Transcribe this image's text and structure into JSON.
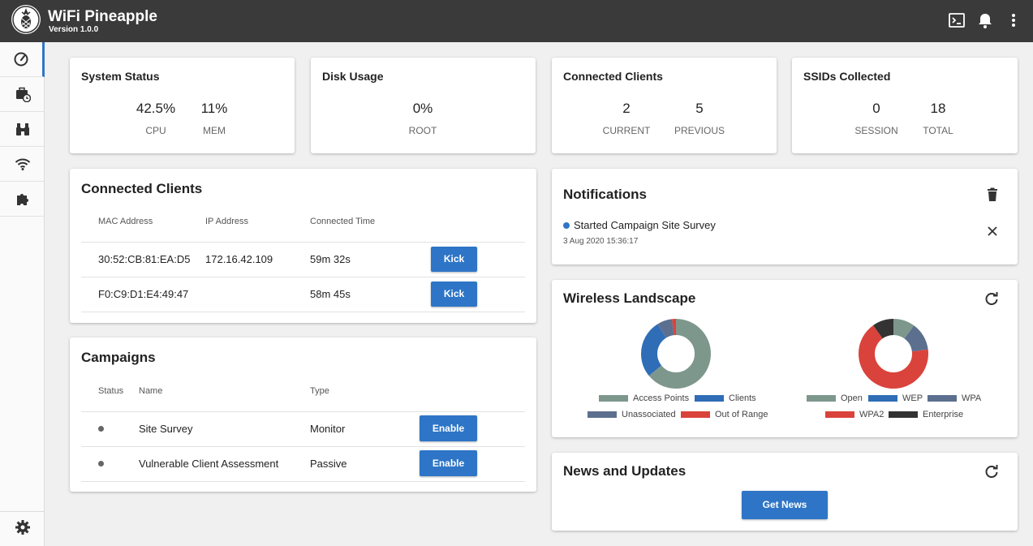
{
  "app": {
    "title": "WiFi Pineapple",
    "version": "Version 1.0.0"
  },
  "topbar": {
    "icons": [
      "terminal-icon",
      "bell-icon",
      "more-vertical-icon"
    ]
  },
  "sidebar": {
    "items": [
      {
        "icon": "dashboard-gauge-icon",
        "active": true
      },
      {
        "icon": "campaigns-briefcase-icon"
      },
      {
        "icon": "recon-binoculars-icon"
      },
      {
        "icon": "wifi-icon"
      },
      {
        "icon": "modules-puzzle-icon"
      }
    ],
    "bottom_icon": "gear-icon"
  },
  "system_status": {
    "title": "System Status",
    "cpu": "42.5%",
    "cpu_label": "CPU",
    "mem": "11%",
    "mem_label": "MEM"
  },
  "disk_usage": {
    "title": "Disk Usage",
    "root": "0%",
    "root_label": "ROOT"
  },
  "connected_summary": {
    "title": "Connected Clients",
    "current": "2",
    "current_label": "CURRENT",
    "previous": "5",
    "previous_label": "PREVIOUS"
  },
  "ssids": {
    "title": "SSIDs Collected",
    "session": "0",
    "session_label": "SESSION",
    "total": "18",
    "total_label": "TOTAL"
  },
  "clients_table": {
    "title": "Connected Clients",
    "headers": [
      "MAC Address",
      "IP Address",
      "Connected Time"
    ],
    "rows": [
      {
        "mac": "30:52:CB:81:EA:D5",
        "ip": "172.16.42.109",
        "time": "59m 32s",
        "action": "Kick"
      },
      {
        "mac": "F0:C9:D1:E4:49:47",
        "ip": "",
        "time": "58m 45s",
        "action": "Kick"
      }
    ]
  },
  "campaigns": {
    "title": "Campaigns",
    "headers": [
      "Status",
      "Name",
      "Type"
    ],
    "rows": [
      {
        "name": "Site Survey",
        "type": "Monitor",
        "action": "Enable"
      },
      {
        "name": "Vulnerable Client Assessment",
        "type": "Passive",
        "action": "Enable"
      }
    ]
  },
  "notifications": {
    "title": "Notifications",
    "items": [
      {
        "text": "Started Campaign Site Survey",
        "time": "3 Aug 2020 15:36:17"
      }
    ]
  },
  "wireless": {
    "title": "Wireless Landscape",
    "chart1": {
      "legend": [
        "Access Points",
        "Clients",
        "Unassociated",
        "Out of Range"
      ],
      "colors": [
        "#7e978c",
        "#2f6db7",
        "#5c6f8f",
        "#d9433b"
      ],
      "shares": [
        0.64,
        0.27,
        0.07,
        0.02
      ]
    },
    "chart2": {
      "legend": [
        "Open",
        "WEP",
        "WPA",
        "WPA2",
        "Enterprise"
      ],
      "colors": [
        "#7e978c",
        "#2f6db7",
        "#5c6f8f",
        "#d9433b",
        "#333333"
      ],
      "shares": [
        0.1,
        0.0,
        0.13,
        0.67,
        0.1
      ]
    }
  },
  "news": {
    "title": "News and Updates",
    "button": "Get News"
  }
}
